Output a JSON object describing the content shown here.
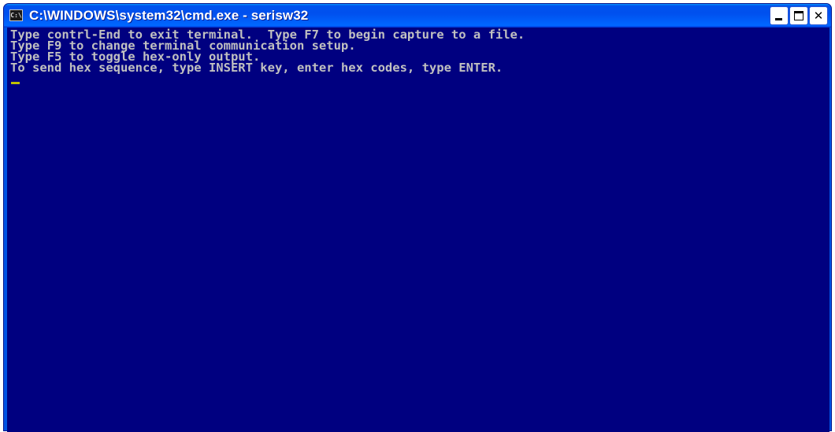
{
  "window": {
    "title": "C:\\WINDOWS\\system32\\cmd.exe - serisw32",
    "icon_label": "C:\\",
    "controls": {
      "minimize": "minimize-icon",
      "maximize": "maximize-icon",
      "close": "close-icon"
    }
  },
  "console": {
    "lines": [
      "Type contrl-End to exit terminal.  Type F7 to begin capture to a file.",
      "Type F9 to change terminal communication setup.",
      "Type F5 to toggle hex-only output.",
      "To send hex sequence, type INSERT key, enter hex codes, type ENTER."
    ],
    "text_color": "#c0c0c0",
    "background_color": "#000080",
    "cursor_color": "#c0c000"
  }
}
